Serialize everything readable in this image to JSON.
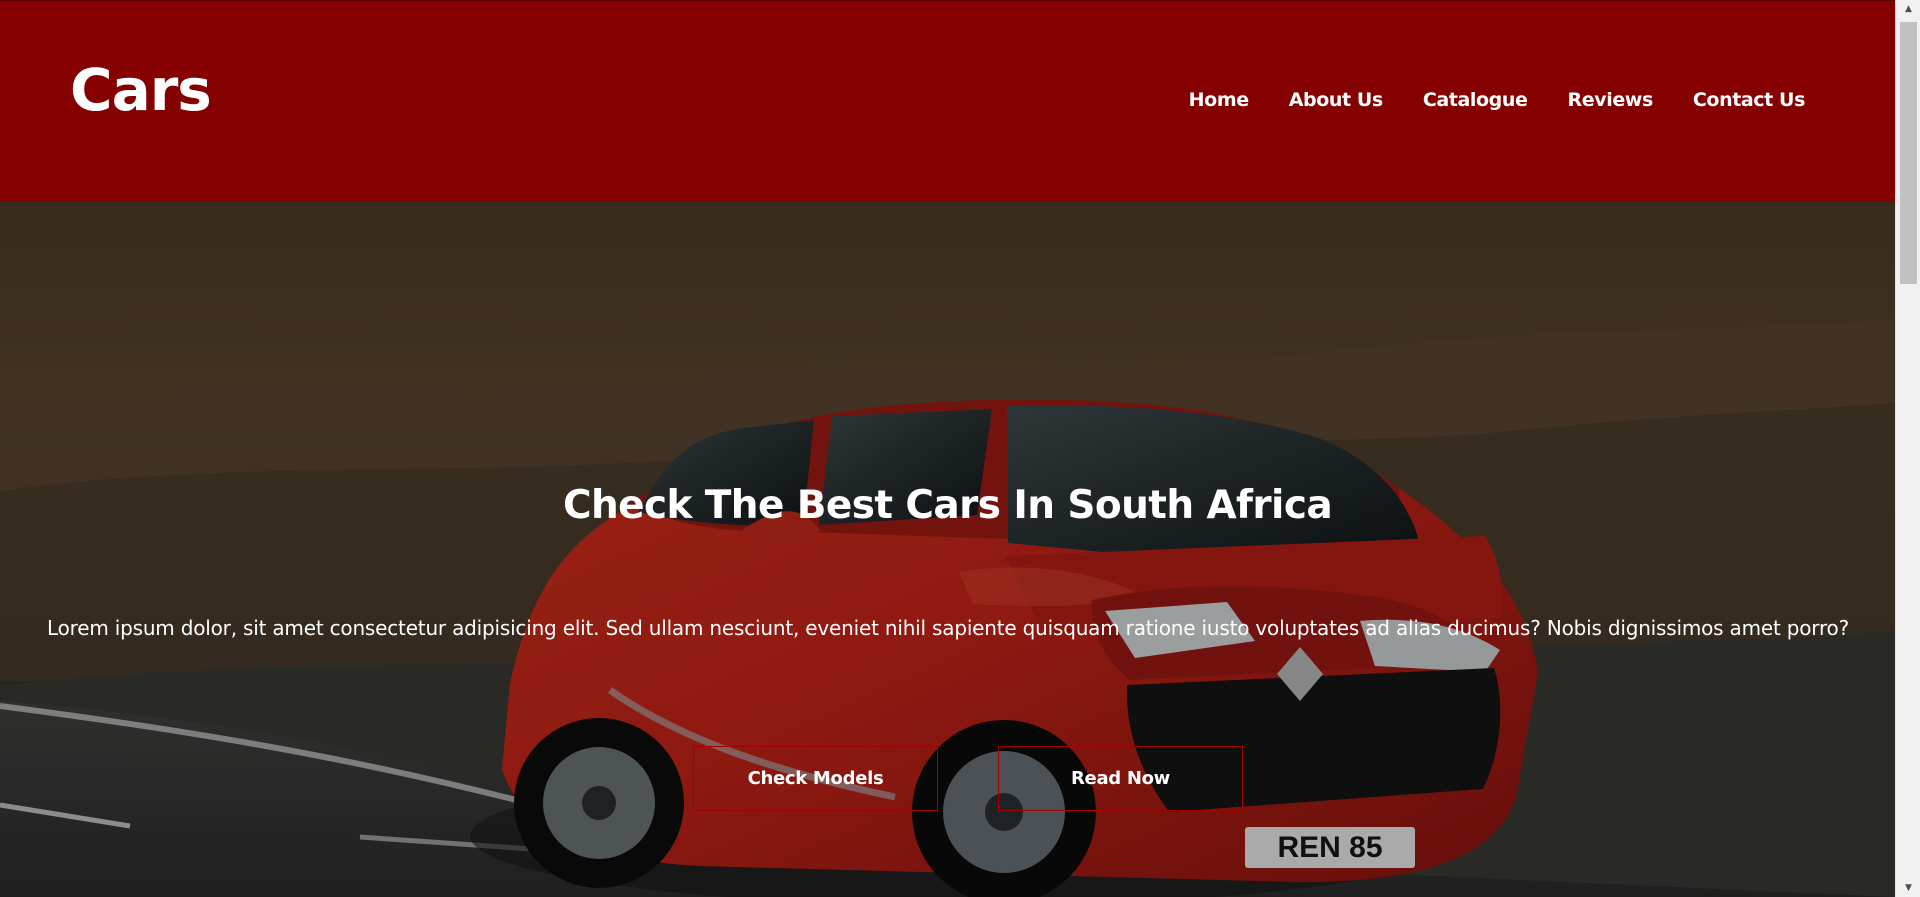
{
  "header": {
    "logo": "Cars",
    "nav": [
      {
        "label": "Home"
      },
      {
        "label": "About Us"
      },
      {
        "label": "Catalogue"
      },
      {
        "label": "Reviews"
      },
      {
        "label": "Contact Us"
      }
    ]
  },
  "hero": {
    "title": "Check The Best Cars In South Africa",
    "text": "Lorem ipsum dolor, sit amet consectetur adipisicing elit. Sed ullam nesciunt, eveniet nihil sapiente quisquam ratione iusto voluptates ad alias ducimus? Nobis dignissimos amet porro?",
    "buttons": [
      {
        "label": "Check Models"
      },
      {
        "label": "Read Now"
      }
    ],
    "image_plate": "REN 85"
  },
  "colors": {
    "header_bg": "#850000",
    "button_border": "#a30000",
    "text": "#ffffff"
  }
}
